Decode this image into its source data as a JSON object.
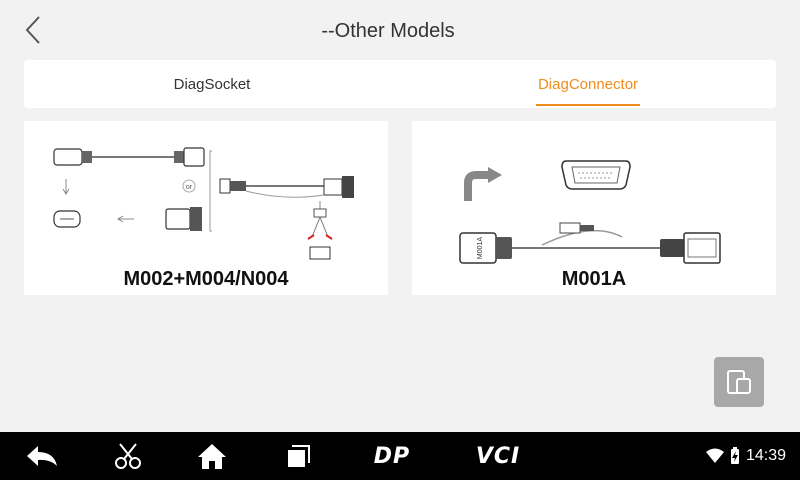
{
  "header": {
    "title": "--Other Models"
  },
  "tabs": [
    {
      "label": "DiagSocket",
      "active": false
    },
    {
      "label": "DiagConnector",
      "active": true
    }
  ],
  "cards": [
    {
      "label": "M002+M004/N004"
    },
    {
      "label": "M001A"
    }
  ],
  "illustration_text": {
    "or": "or",
    "cable_tag": "M001A"
  },
  "navbar": {
    "dp_label": "DP",
    "vci_label": "VCI",
    "time": "14:39"
  },
  "colors": {
    "accent": "#f08c1c",
    "background": "#f2f2f2",
    "navbar": "#000000"
  }
}
